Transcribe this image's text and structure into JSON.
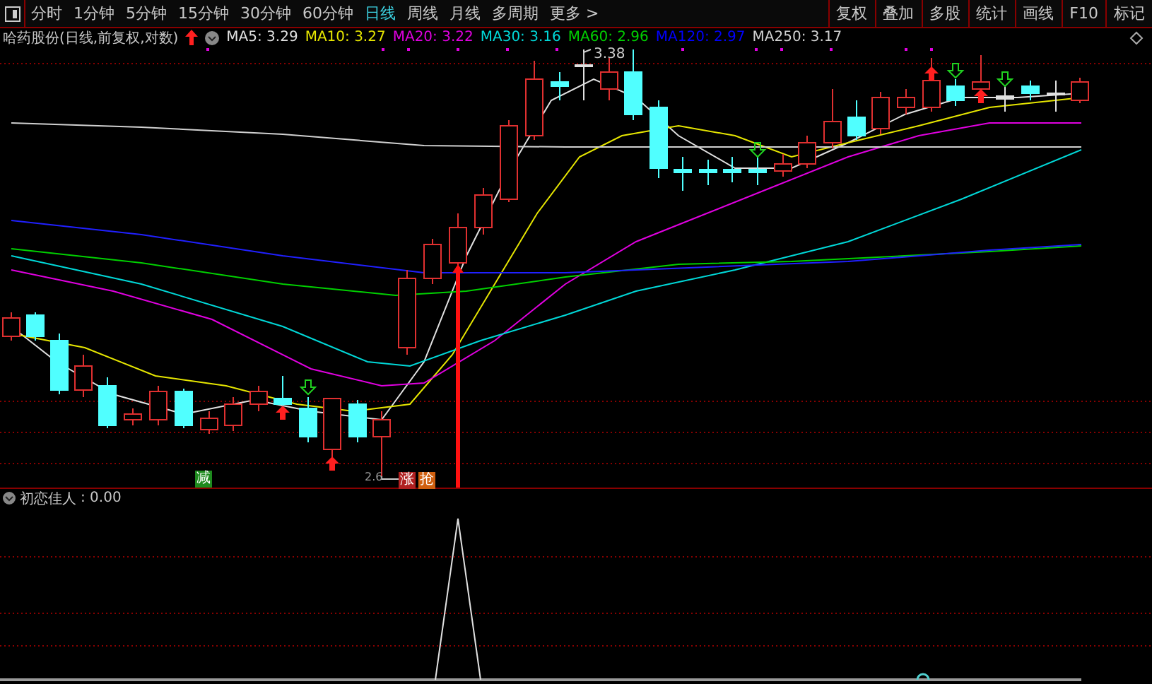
{
  "toolbar": {
    "periods": [
      {
        "label": "分时",
        "selected": false
      },
      {
        "label": "1分钟",
        "selected": false
      },
      {
        "label": "5分钟",
        "selected": false
      },
      {
        "label": "15分钟",
        "selected": false
      },
      {
        "label": "30分钟",
        "selected": false
      },
      {
        "label": "60分钟",
        "selected": false
      },
      {
        "label": "日线",
        "selected": true
      },
      {
        "label": "周线",
        "selected": false
      },
      {
        "label": "月线",
        "selected": false
      },
      {
        "label": "多周期",
        "selected": false
      },
      {
        "label": "更多 >",
        "selected": false
      }
    ],
    "actions": [
      "复权",
      "叠加",
      "多股",
      "统计",
      "画线",
      "F10",
      "标记"
    ]
  },
  "chart": {
    "title": "哈药股份(日线,前复权,对数)",
    "legend": [
      {
        "label": "MA5: 3.29",
        "color": "#e0e0e0"
      },
      {
        "label": "MA10: 3.27",
        "color": "#e6e600"
      },
      {
        "label": "MA20: 3.22",
        "color": "#e000e0"
      },
      {
        "label": "MA30: 3.16",
        "color": "#00d8d8"
      },
      {
        "label": "MA60: 2.96",
        "color": "#00d000"
      },
      {
        "label": "MA120: 2.97",
        "color": "#0000ff"
      },
      {
        "label": "MA250: 3.17",
        "color": "#d0d0d0"
      }
    ],
    "high_label": "3.38",
    "low_label": "2.6",
    "badges": [
      {
        "label": "减",
        "color": "#1e8a1e"
      },
      {
        "label": "涨",
        "color": "#b02020"
      },
      {
        "label": "抢",
        "color": "#d06010"
      }
    ]
  },
  "indicator": {
    "name": "初恋佳人",
    "value": ": 0.00"
  }
}
